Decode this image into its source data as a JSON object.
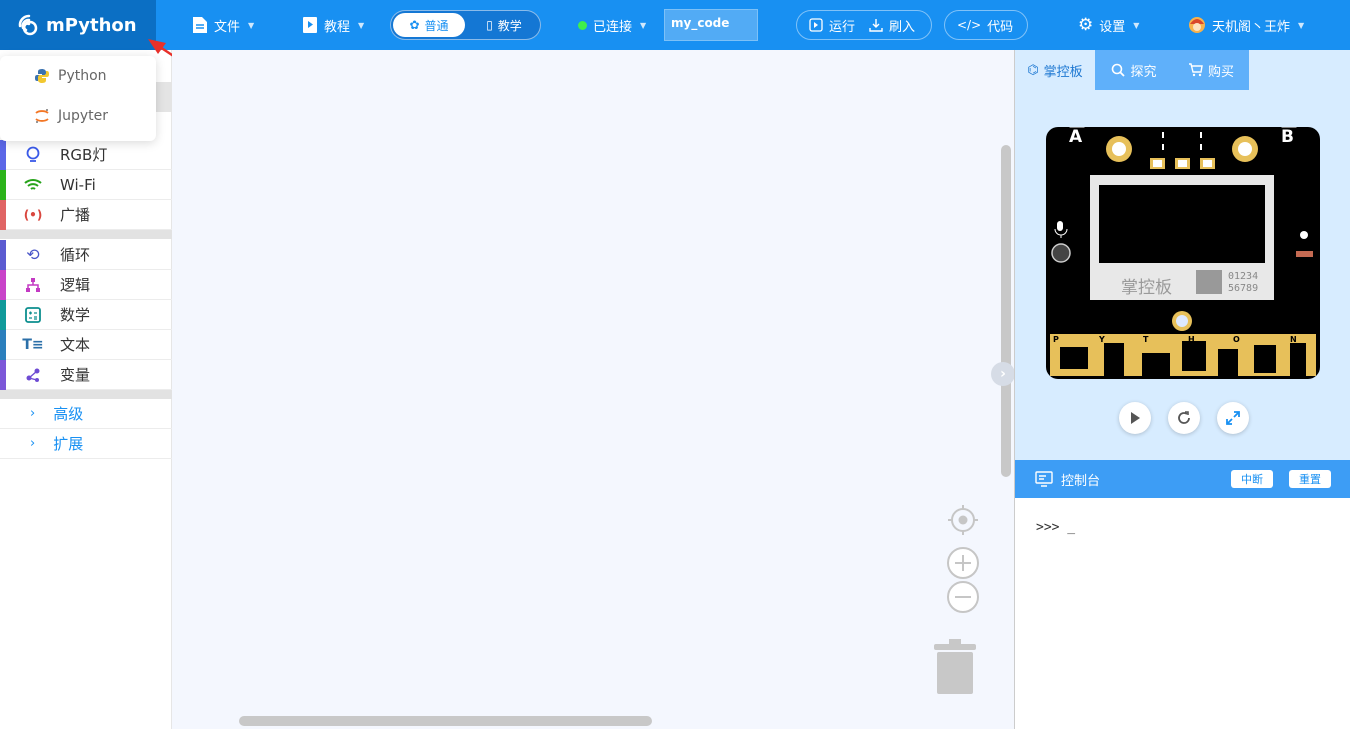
{
  "app": {
    "name": "mPython"
  },
  "menu": {
    "file": "文件",
    "tutorial": "教程",
    "mode_normal": "普通",
    "mode_teach": "教学",
    "connection": "已连接",
    "filename": "my_code",
    "run": "运行",
    "flash": "刷入",
    "code": "代码",
    "settings": "设置",
    "user": "天机阁丶王炸"
  },
  "logo_dropdown": {
    "items": [
      {
        "label": "Python"
      },
      {
        "label": "Jupyter"
      }
    ]
  },
  "categories": [
    {
      "label": "RGB灯",
      "color": "#5b67e7",
      "icon": "bulb-icon"
    },
    {
      "label": "Wi-Fi",
      "color": "#2bb31a",
      "icon": "wifi-icon"
    },
    {
      "label": "广播",
      "color": "#e06464",
      "icon": "broadcast-icon"
    },
    {
      "label": "循环",
      "color": "#5b5bd1",
      "icon": "loop-icon"
    },
    {
      "label": "逻辑",
      "color": "#c943c9",
      "icon": "logic-icon"
    },
    {
      "label": "数学",
      "color": "#109a9a",
      "icon": "math-icon"
    },
    {
      "label": "文本",
      "color": "#2b7fbd",
      "icon": "text-icon"
    },
    {
      "label": "变量",
      "color": "#7c57d8",
      "icon": "variable-icon"
    }
  ],
  "advanced": [
    {
      "label": "高级"
    },
    {
      "label": "扩展"
    }
  ],
  "sim_tabs": [
    {
      "label": "掌控板"
    },
    {
      "label": "探究"
    },
    {
      "label": "购买"
    }
  ],
  "board": {
    "button_a": "A",
    "button_b": "B",
    "brand": "掌控板",
    "digits_1": "01234",
    "digits_2": "56789",
    "pins": [
      "P",
      "Y",
      "T",
      "H",
      "O",
      "N"
    ]
  },
  "console": {
    "title": "控制台",
    "interrupt": "中断",
    "reset": "重置",
    "prompt": ">>> _"
  },
  "colors": {
    "primary": "#1890f2",
    "primary_dark": "#0b6fc4",
    "connected": "#3ff04c",
    "board_gold": "#e7c05a"
  }
}
